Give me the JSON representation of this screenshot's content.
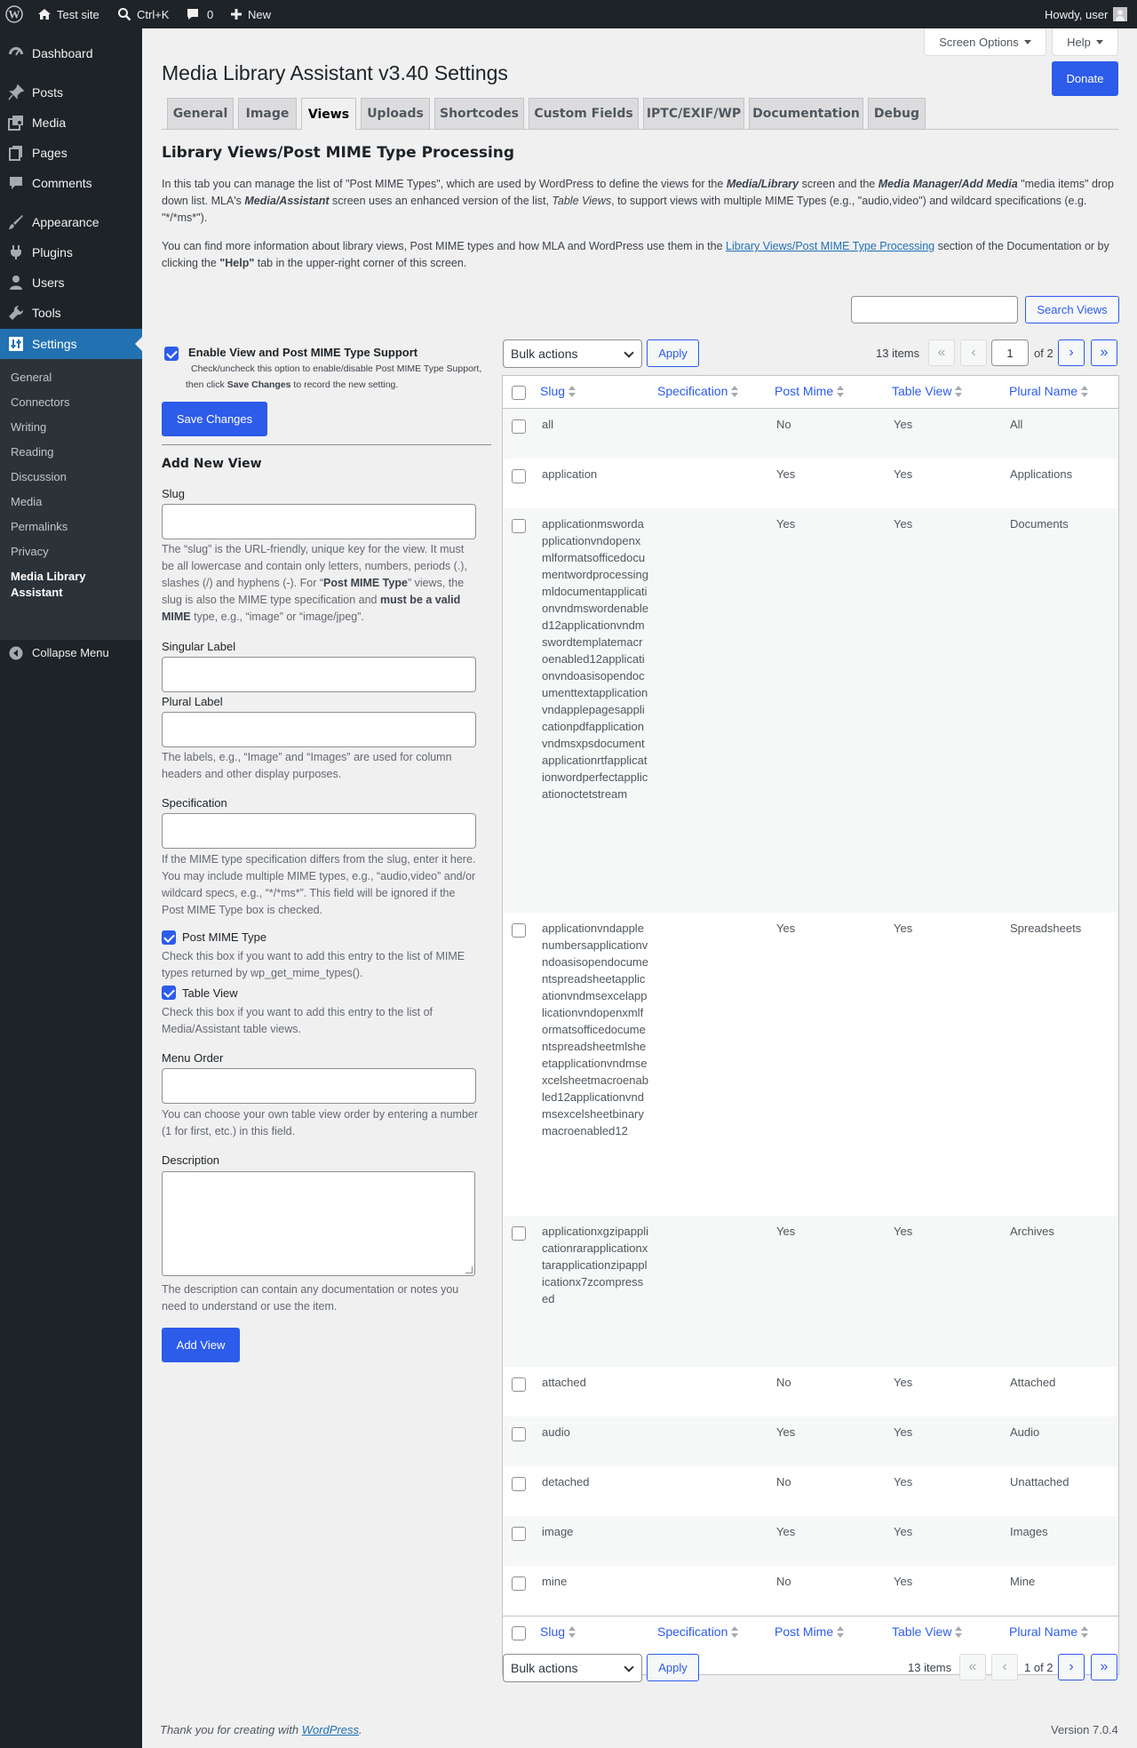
{
  "adminbar": {
    "site": "Test site",
    "search": "Ctrl+K",
    "comments": "0",
    "new": "New",
    "howdy": "Howdy, user"
  },
  "menu": {
    "items": [
      "Dashboard",
      "Posts",
      "Media",
      "Pages",
      "Comments",
      "Appearance",
      "Plugins",
      "Users",
      "Tools",
      "Settings"
    ],
    "settings_sub": [
      "General",
      "Connectors",
      "Writing",
      "Reading",
      "Discussion",
      "Media",
      "Permalinks",
      "Privacy",
      "Media Library Assistant"
    ],
    "collapse": "Collapse Menu"
  },
  "header": {
    "screen_options": "Screen Options",
    "help": "Help",
    "donate": "Donate",
    "title": "Media Library Assistant v3.40 Settings"
  },
  "tabs": [
    "General",
    "Image",
    "Views",
    "Uploads",
    "Shortcodes",
    "Custom Fields",
    "IPTC/EXIF/WP",
    "Documentation",
    "Debug"
  ],
  "section": {
    "title": "Library Views/Post MIME Type Processing",
    "p1a": "In this tab you can manage the list of \"Post MIME Types\", which are used by WordPress to define the views for the ",
    "p1b": "Media/Library",
    "p1c": " screen and the ",
    "p1d": "Media Manager/Add Media",
    "p1e": " \"media items\" drop down list. MLA's ",
    "p1f": "Media/Assistant",
    "p1g": " screen uses an enhanced version of the list, ",
    "p1h": "Table Views",
    "p1i": ", to support views with multiple MIME Types (e.g., \"audio,video\") and wildcard specifications (e.g. \"*/*ms*\").",
    "p2a": "You can find more information about library views, Post MIME types and how MLA and WordPress use them in the ",
    "p2link": "Library Views/Post MIME Type Processing",
    "p2b": " section of the Documentation or by clicking the ",
    "p2bold": "\"Help\"",
    "p2c": " tab in the upper-right corner of this screen."
  },
  "search": {
    "button": "Search Views",
    "value": ""
  },
  "enable": {
    "label": "Enable View and Post MIME Type Support",
    "help1": "Check/uncheck this option to enable/disable Post MIME Type Support,",
    "help2a": "then click ",
    "help2b": "Save Changes",
    "help2c": " to record the new setting.",
    "checked": true
  },
  "save_changes": "Save Changes",
  "form": {
    "heading": "Add New View",
    "slug_label": "Slug",
    "slug_help_a": "The “slug” is the URL-friendly, unique key for the view. It must be all lowercase and contain only letters, numbers, periods (.), slashes (/) and hyphens (-). For “",
    "slug_help_b": "Post MIME Type",
    "slug_help_c": "” views, the slug is also the MIME type specification and ",
    "slug_help_d": "must be a valid MIME",
    "slug_help_e": " type, e.g., “image” or “image/jpeg”.",
    "singular_label": "Singular Label",
    "plural_label": "Plural Label",
    "labels_help": "The labels, e.g., “Image” and “Images” are used for column headers and other display purposes.",
    "spec_label": "Specification",
    "spec_help": "If the MIME type specification differs from the slug, enter it here. You may include multiple MIME types, e.g., “audio,video” and/or wildcard specs, e.g., “*/*ms*”. This field will be ignored if the Post MIME Type box is checked.",
    "post_mime_label": "Post MIME Type",
    "post_mime_help": "Check this box if you want to add this entry to the list of MIME types returned by wp_get_mime_types().",
    "table_view_label": "Table View",
    "table_view_help": "Check this box if you want to add this entry to the list of Media/Assistant table views.",
    "menu_order_label": "Menu Order",
    "menu_order_help": "You can choose your own table view order by entering a number (1 for first, etc.) in this field.",
    "description_label": "Description",
    "description_help": "The description can contain any documentation or notes you need to understand or use the item.",
    "add_view": "Add View"
  },
  "list": {
    "bulk_actions": "Bulk actions",
    "apply": "Apply",
    "items": "13 items",
    "page": "1",
    "of_pages": "of 2",
    "bottom_page": "1 of 2",
    "columns": [
      "Slug",
      "Specification",
      "Post Mime",
      "Table View",
      "Plural Name"
    ],
    "rows": [
      {
        "slug": "all",
        "spec": "",
        "post_mime": "No",
        "table_view": "Yes",
        "plural": "All"
      },
      {
        "slug": "application",
        "spec": "",
        "post_mime": "Yes",
        "table_view": "Yes",
        "plural": "Applications"
      },
      {
        "slug": "applicationmswordapplicationvndopenxmlformatsofficedocumentwordprocessingmldocumentapplicationvndmswordenabled12applicationvndmswordtemplatemacroenabled12applicationvndoasisopendocumenttextapplicationvndapplepagesapplicationpdfapplicationvndmsxpsdocumentapplicationrtfapplicationwordperfectapplicationoctetstream",
        "spec": "",
        "post_mime": "Yes",
        "table_view": "Yes",
        "plural": "Documents"
      },
      {
        "slug": "applicationvndapplenumbersapplicationvndoasisopendocumentspreadsheetapplicationvndmsexcelapplicationvndopenxmlformatsofficedocumentspreadsheetmlsheetapplicationvndmsexcelsheetmacroenabled12applicationvndmsexcelsheetbinarymacroenabled12",
        "spec": "",
        "post_mime": "Yes",
        "table_view": "Yes",
        "plural": "Spreadsheets"
      },
      {
        "slug": "applicationxgzipapplicationrarapplicationxtarapplicationzipapplicationx7zcompressed",
        "spec": "",
        "post_mime": "Yes",
        "table_view": "Yes",
        "plural": "Archives"
      },
      {
        "slug": "attached",
        "spec": "",
        "post_mime": "No",
        "table_view": "Yes",
        "plural": "Attached"
      },
      {
        "slug": "audio",
        "spec": "",
        "post_mime": "Yes",
        "table_view": "Yes",
        "plural": "Audio"
      },
      {
        "slug": "detached",
        "spec": "",
        "post_mime": "No",
        "table_view": "Yes",
        "plural": "Unattached"
      },
      {
        "slug": "image",
        "spec": "",
        "post_mime": "Yes",
        "table_view": "Yes",
        "plural": "Images"
      },
      {
        "slug": "mine",
        "spec": "",
        "post_mime": "No",
        "table_view": "Yes",
        "plural": "Mine"
      }
    ]
  },
  "footer": {
    "thanks": "Thank you for creating with ",
    "wp": "WordPress",
    "period": ".",
    "version": "Version 7.0.4"
  }
}
